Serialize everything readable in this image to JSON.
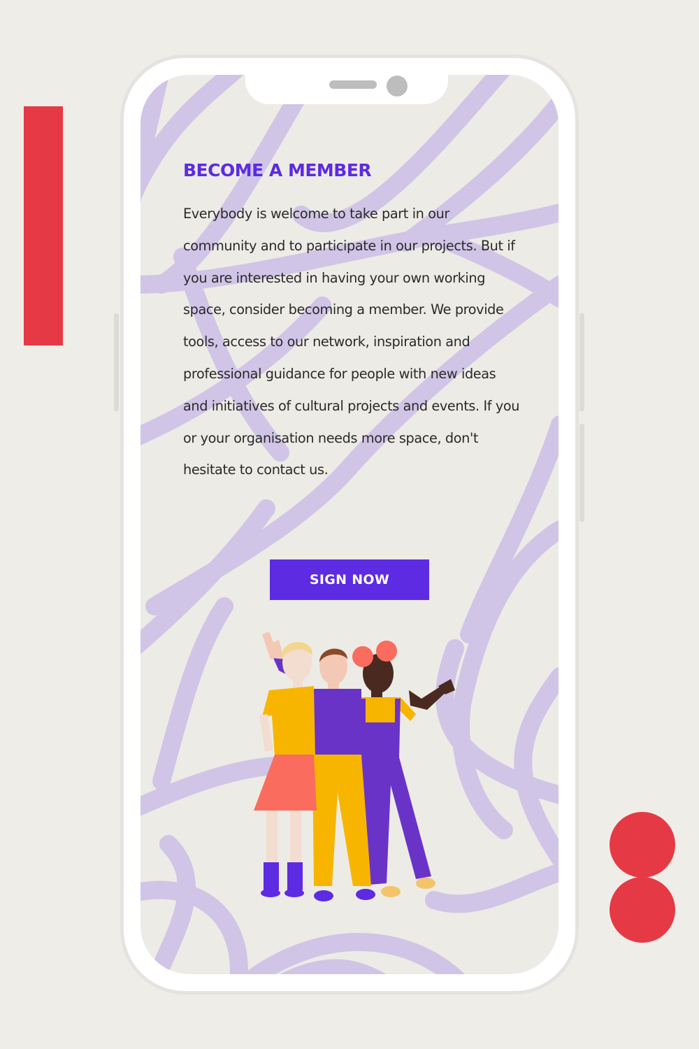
{
  "colors": {
    "background": "#efede8",
    "accent_red": "#e63946",
    "brand_purple": "#5c2be2",
    "scribble_lilac": "#cfc3e6",
    "text": "#2a2a2a"
  },
  "member_section": {
    "title": "BECOME A MEMBER",
    "body": "Everybody is welcome to take part in our community and to participate in our projects. But if you are interested in having your own working space, consider becoming a member. We provide tools, access to our network, inspiration and professional guidance for people with new ideas and initiatives of cultural projects and events. If you or your organisation needs more space, don't hesitate to contact us.",
    "button_label": "SIGN NOW"
  },
  "illustration": {
    "icon": "group-of-three-people-illustration"
  }
}
